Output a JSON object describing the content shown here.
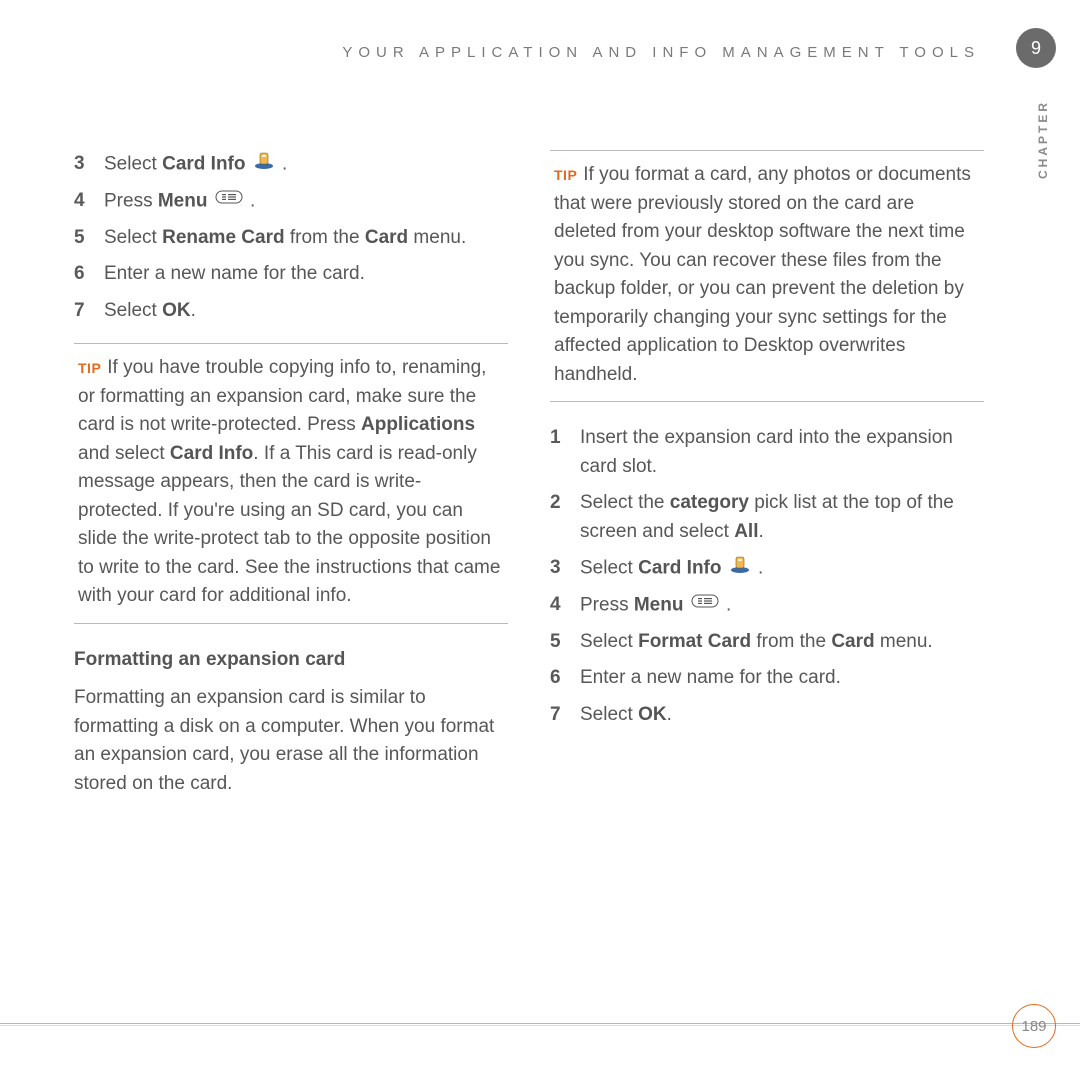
{
  "header": "YOUR APPLICATION AND INFO MANAGEMENT TOOLS",
  "chapter_label": "CHAPTER",
  "chapter_number": "9",
  "page_number": "189",
  "left": {
    "step3": {
      "num": "3",
      "pre": "Select ",
      "bold": "Card Info",
      "post": " ."
    },
    "step4": {
      "num": "4",
      "pre": "Press ",
      "bold": "Menu",
      "post": " ."
    },
    "step5": {
      "num": "5",
      "pre": "Select ",
      "bold1": "Rename Card",
      "mid": " from the ",
      "bold2": "Card",
      "post": " menu."
    },
    "step6": {
      "num": "6",
      "text": "Enter a new name for the card."
    },
    "step7": {
      "num": "7",
      "pre": "Select ",
      "bold": "OK",
      "post": "."
    },
    "tip_label": "TIP",
    "tip_a": "If you have trouble copying info to, renaming, or formatting an expansion card, make sure the card is not write-protected. Press ",
    "tip_b1": "Applications",
    "tip_c": " and select ",
    "tip_b2": "Card Info",
    "tip_d": ". If a This card is read-only message appears, then the card is write-protected. If you're using an SD card, you can slide the write-protect tab to the opposite position to write to the card. See the instructions that came with your card for additional info.",
    "heading": "Formatting an expansion card",
    "body": "Formatting an expansion card is similar to formatting a disk on a computer. When you format an expansion card, you erase all the information stored on the card."
  },
  "right": {
    "tip_label": "TIP",
    "tip_text": "If you format a card, any photos or documents that were previously stored on the card are deleted from your desktop software the next time you sync. You can recover these files from the backup folder, or you can prevent the deletion by temporarily changing your sync settings for the affected application to Desktop overwrites handheld.",
    "step1": {
      "num": "1",
      "text": "Insert the expansion card into the expansion card slot."
    },
    "step2": {
      "num": "2",
      "pre": "Select the ",
      "bold1": "category",
      "mid": " pick list at the top of the screen and select ",
      "bold2": "All",
      "post": "."
    },
    "step3": {
      "num": "3",
      "pre": "Select ",
      "bold": "Card Info",
      "post": " ."
    },
    "step4": {
      "num": "4",
      "pre": "Press ",
      "bold": "Menu",
      "post": " ."
    },
    "step5": {
      "num": "5",
      "pre": "Select ",
      "bold1": "Format Card",
      "mid": " from the ",
      "bold2": "Card",
      "post": " menu."
    },
    "step6": {
      "num": "6",
      "text": "Enter a new name for the card."
    },
    "step7": {
      "num": "7",
      "pre": "Select ",
      "bold": "OK",
      "post": "."
    }
  }
}
